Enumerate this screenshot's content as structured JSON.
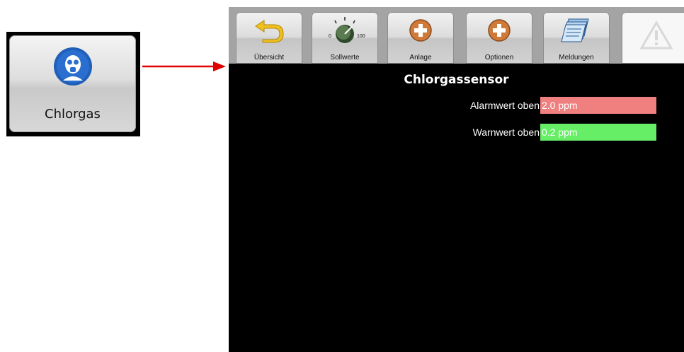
{
  "tile": {
    "label": "Chlorgas",
    "icon": "gas-mask-person-icon"
  },
  "arrow": {
    "icon": "red-arrow-right-icon",
    "color": "#e00000"
  },
  "toolbar": {
    "buttons": [
      {
        "label": "Übersicht",
        "icon": "back-arrow-icon"
      },
      {
        "label": "Sollwerte",
        "icon": "dial-knob-icon",
        "dial_min": "0",
        "dial_max": "100"
      },
      {
        "label": "Anlage",
        "icon": "plus-circle-icon"
      },
      {
        "label": "Optionen",
        "icon": "plus-circle-icon"
      },
      {
        "label": "Meldungen",
        "icon": "documents-icon"
      },
      {
        "label": "",
        "icon": "warning-triangle-icon"
      }
    ]
  },
  "main": {
    "title": "Chlorgassensor",
    "fields": [
      {
        "label": "Alarmwert oben",
        "value": "2.0 ppm",
        "color": "#f08080"
      },
      {
        "label": "Warnwert oben",
        "value": "0.2 ppm",
        "color": "#66ee66"
      }
    ]
  }
}
